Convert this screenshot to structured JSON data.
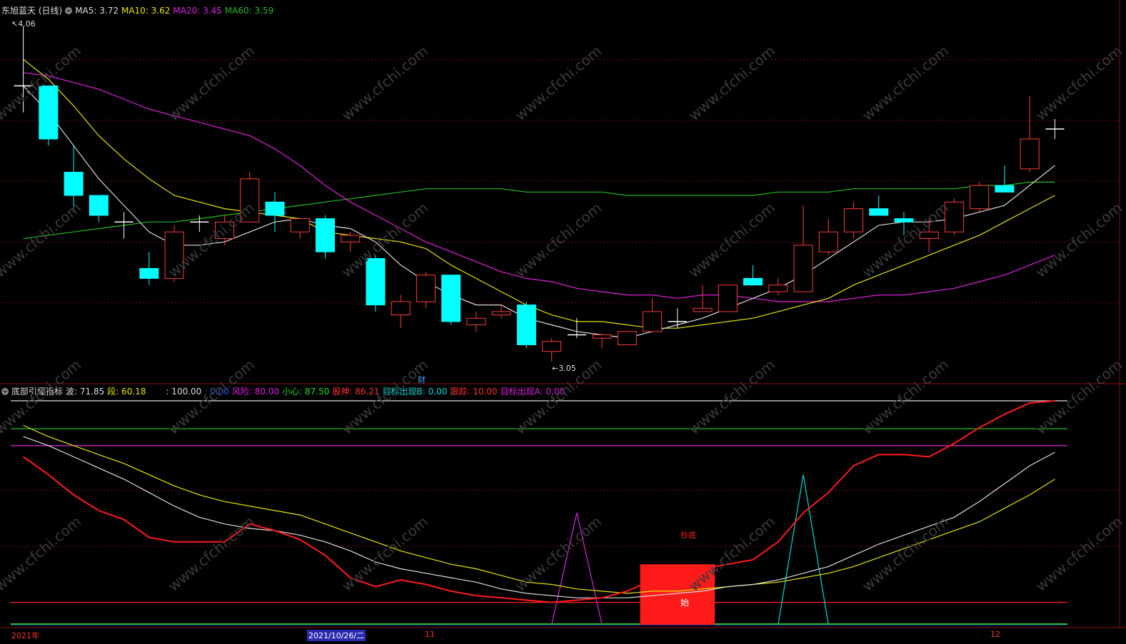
{
  "top_header": {
    "stock_name": "东旭蓝天 (日线)",
    "ma5": "MA5: 3.72",
    "ma10": "MA10: 3.62",
    "ma20": "MA20: 3.45",
    "ma60": "MA60: 3.59"
  },
  "bottom_header": {
    "indicator_name": "底部引爆指标",
    "wave": "波: 71.85",
    "segment": "段: 60.18",
    "level100": ": 100.00",
    "zero": ": 0.00",
    "risk": "风险: 80.00",
    "careful": "小心: 87.50",
    "stock_god": "股神: 86.21",
    "target_b": "目标出现B: 0.00",
    "follow": "跟踪: 10.00",
    "target_a": "目标出现A: 0.00"
  },
  "annotations": {
    "high_price": "4.06",
    "low_price": "3.05",
    "cai_marker": "财",
    "chaodi": "抄底",
    "shi": "始"
  },
  "date_axis": {
    "year": "2021年",
    "selected_date": "2021/10/26/二",
    "month_11": "11",
    "month_12": "12"
  },
  "watermark": "www.cfchi.com",
  "colors": {
    "up": "#ff3b3b",
    "down": "#00ffff",
    "ma5": "#dddddd",
    "ma10": "#e6e600",
    "ma20": "#e020e0",
    "ma60": "#22bb22",
    "indicator_red": "#ff1a1a"
  },
  "chart_data": [
    {
      "type": "candlestick",
      "title": "东旭蓝天 (日线)",
      "ylim": [
        3.0,
        4.1
      ],
      "candles": [
        {
          "o": 3.88,
          "c": 3.88,
          "h": 4.06,
          "l": 3.8
        },
        {
          "o": 3.88,
          "c": 3.72,
          "h": 3.88,
          "l": 3.7
        },
        {
          "o": 3.62,
          "c": 3.55,
          "h": 3.7,
          "l": 3.5
        },
        {
          "o": 3.55,
          "c": 3.49,
          "h": 3.55,
          "l": 3.47
        },
        {
          "o": 3.47,
          "c": 3.47,
          "h": 3.5,
          "l": 3.42
        },
        {
          "o": 3.33,
          "c": 3.3,
          "h": 3.38,
          "l": 3.28
        },
        {
          "o": 3.3,
          "c": 3.44,
          "h": 3.46,
          "l": 3.29
        },
        {
          "o": 3.47,
          "c": 3.47,
          "h": 3.49,
          "l": 3.44
        },
        {
          "o": 3.42,
          "c": 3.47,
          "h": 3.49,
          "l": 3.4
        },
        {
          "o": 3.47,
          "c": 3.6,
          "h": 3.62,
          "l": 3.47
        },
        {
          "o": 3.53,
          "c": 3.49,
          "h": 3.56,
          "l": 3.44
        },
        {
          "o": 3.44,
          "c": 3.48,
          "h": 3.48,
          "l": 3.42
        },
        {
          "o": 3.48,
          "c": 3.38,
          "h": 3.49,
          "l": 3.36
        },
        {
          "o": 3.41,
          "c": 3.43,
          "h": 3.44,
          "l": 3.38
        },
        {
          "o": 3.36,
          "c": 3.22,
          "h": 3.37,
          "l": 3.2
        },
        {
          "o": 3.19,
          "c": 3.23,
          "h": 3.25,
          "l": 3.15
        },
        {
          "o": 3.23,
          "c": 3.31,
          "h": 3.32,
          "l": 3.21
        },
        {
          "o": 3.31,
          "c": 3.17,
          "h": 3.31,
          "l": 3.16
        },
        {
          "o": 3.16,
          "c": 3.18,
          "h": 3.2,
          "l": 3.14
        },
        {
          "o": 3.19,
          "c": 3.2,
          "h": 3.22,
          "l": 3.18
        },
        {
          "o": 3.22,
          "c": 3.1,
          "h": 3.23,
          "l": 3.09
        },
        {
          "o": 3.08,
          "c": 3.11,
          "h": 3.12,
          "l": 3.05
        },
        {
          "o": 3.13,
          "c": 3.13,
          "h": 3.18,
          "l": 3.12
        },
        {
          "o": 3.12,
          "c": 3.13,
          "h": 3.13,
          "l": 3.09
        },
        {
          "o": 3.1,
          "c": 3.14,
          "h": 3.14,
          "l": 3.1
        },
        {
          "o": 3.14,
          "c": 3.2,
          "h": 3.24,
          "l": 3.14
        },
        {
          "o": 3.17,
          "c": 3.17,
          "h": 3.21,
          "l": 3.15
        },
        {
          "o": 3.2,
          "c": 3.21,
          "h": 3.28,
          "l": 3.2
        },
        {
          "o": 3.2,
          "c": 3.28,
          "h": 3.28,
          "l": 3.2
        },
        {
          "o": 3.3,
          "c": 3.28,
          "h": 3.34,
          "l": 3.28
        },
        {
          "o": 3.26,
          "c": 3.28,
          "h": 3.3,
          "l": 3.25
        },
        {
          "o": 3.26,
          "c": 3.4,
          "h": 3.52,
          "l": 3.26
        },
        {
          "o": 3.38,
          "c": 3.44,
          "h": 3.48,
          "l": 3.37
        },
        {
          "o": 3.44,
          "c": 3.51,
          "h": 3.53,
          "l": 3.42
        },
        {
          "o": 3.51,
          "c": 3.49,
          "h": 3.55,
          "l": 3.49
        },
        {
          "o": 3.48,
          "c": 3.47,
          "h": 3.5,
          "l": 3.43
        },
        {
          "o": 3.42,
          "c": 3.44,
          "h": 3.48,
          "l": 3.38
        },
        {
          "o": 3.44,
          "c": 3.53,
          "h": 3.54,
          "l": 3.43
        },
        {
          "o": 3.51,
          "c": 3.58,
          "h": 3.59,
          "l": 3.5
        },
        {
          "o": 3.58,
          "c": 3.56,
          "h": 3.64,
          "l": 3.56
        },
        {
          "o": 3.63,
          "c": 3.72,
          "h": 3.85,
          "l": 3.62
        },
        {
          "o": 3.75,
          "c": 3.75,
          "h": 3.78,
          "l": 3.72
        }
      ],
      "ma5": [
        3.88,
        3.8,
        3.7,
        3.6,
        3.52,
        3.44,
        3.4,
        3.4,
        3.41,
        3.44,
        3.47,
        3.48,
        3.46,
        3.45,
        3.41,
        3.34,
        3.29,
        3.25,
        3.22,
        3.22,
        3.18,
        3.16,
        3.14,
        3.13,
        3.12,
        3.14,
        3.16,
        3.18,
        3.21,
        3.24,
        3.27,
        3.31,
        3.36,
        3.41,
        3.46,
        3.47,
        3.47,
        3.48,
        3.5,
        3.52,
        3.58,
        3.64
      ],
      "ma10": [
        3.96,
        3.9,
        3.82,
        3.73,
        3.66,
        3.6,
        3.55,
        3.53,
        3.51,
        3.5,
        3.49,
        3.48,
        3.44,
        3.43,
        3.42,
        3.41,
        3.39,
        3.34,
        3.3,
        3.26,
        3.22,
        3.19,
        3.17,
        3.17,
        3.16,
        3.15,
        3.15,
        3.16,
        3.17,
        3.18,
        3.2,
        3.22,
        3.24,
        3.28,
        3.31,
        3.34,
        3.37,
        3.4,
        3.43,
        3.47,
        3.51,
        3.55
      ],
      "ma20": [
        3.92,
        3.91,
        3.89,
        3.87,
        3.84,
        3.81,
        3.79,
        3.77,
        3.75,
        3.73,
        3.69,
        3.64,
        3.58,
        3.53,
        3.49,
        3.45,
        3.41,
        3.38,
        3.35,
        3.32,
        3.3,
        3.29,
        3.27,
        3.26,
        3.25,
        3.25,
        3.24,
        3.25,
        3.25,
        3.24,
        3.23,
        3.23,
        3.23,
        3.24,
        3.25,
        3.25,
        3.26,
        3.27,
        3.29,
        3.31,
        3.34,
        3.37
      ],
      "ma60": [
        3.42,
        3.43,
        3.44,
        3.45,
        3.46,
        3.47,
        3.47,
        3.48,
        3.49,
        3.5,
        3.51,
        3.52,
        3.53,
        3.54,
        3.55,
        3.56,
        3.57,
        3.57,
        3.57,
        3.57,
        3.56,
        3.56,
        3.56,
        3.56,
        3.55,
        3.55,
        3.55,
        3.55,
        3.55,
        3.55,
        3.56,
        3.56,
        3.56,
        3.57,
        3.57,
        3.57,
        3.57,
        3.57,
        3.58,
        3.58,
        3.59,
        3.59
      ]
    },
    {
      "type": "line",
      "title": "底部引爆指标",
      "ylim": [
        0,
        100
      ],
      "levels": [
        100,
        87.5,
        80,
        10,
        0
      ],
      "series": [
        {
          "name": "股神",
          "values": [
            75,
            67,
            58,
            51,
            47,
            39,
            37,
            37,
            37,
            45,
            42,
            38,
            31,
            21,
            17,
            20,
            18,
            15,
            13,
            12,
            11,
            10,
            11,
            12,
            15,
            20,
            22,
            25,
            27,
            29,
            37,
            50,
            59,
            71,
            76,
            76,
            75,
            81,
            88,
            94,
            99,
            100
          ]
        },
        {
          "name": "波",
          "values": [
            84,
            80,
            75,
            70,
            65,
            59,
            53,
            48,
            45,
            43,
            42,
            40,
            37,
            33,
            28,
            25,
            23,
            21,
            19,
            16,
            14,
            13,
            12,
            12,
            12,
            13,
            14,
            15,
            17,
            18,
            20,
            23,
            26,
            31,
            36,
            40,
            44,
            48,
            55,
            63,
            71,
            77
          ]
        },
        {
          "name": "段",
          "values": [
            89,
            84,
            80,
            76,
            72,
            67,
            62,
            58,
            55,
            53,
            51,
            49,
            45,
            41,
            37,
            33,
            30,
            27,
            25,
            22,
            19,
            18,
            16,
            15,
            14,
            15,
            15,
            16,
            17,
            18,
            19,
            21,
            23,
            26,
            30,
            34,
            38,
            42,
            46,
            52,
            58,
            65
          ]
        }
      ],
      "spikes": [
        {
          "name": "目标出现A",
          "index": 22,
          "value": 50
        },
        {
          "name": "目标出现B",
          "index": 31,
          "value": 67
        }
      ],
      "block": {
        "label": "始",
        "from": 25,
        "to": 27,
        "value": 27
      }
    }
  ]
}
